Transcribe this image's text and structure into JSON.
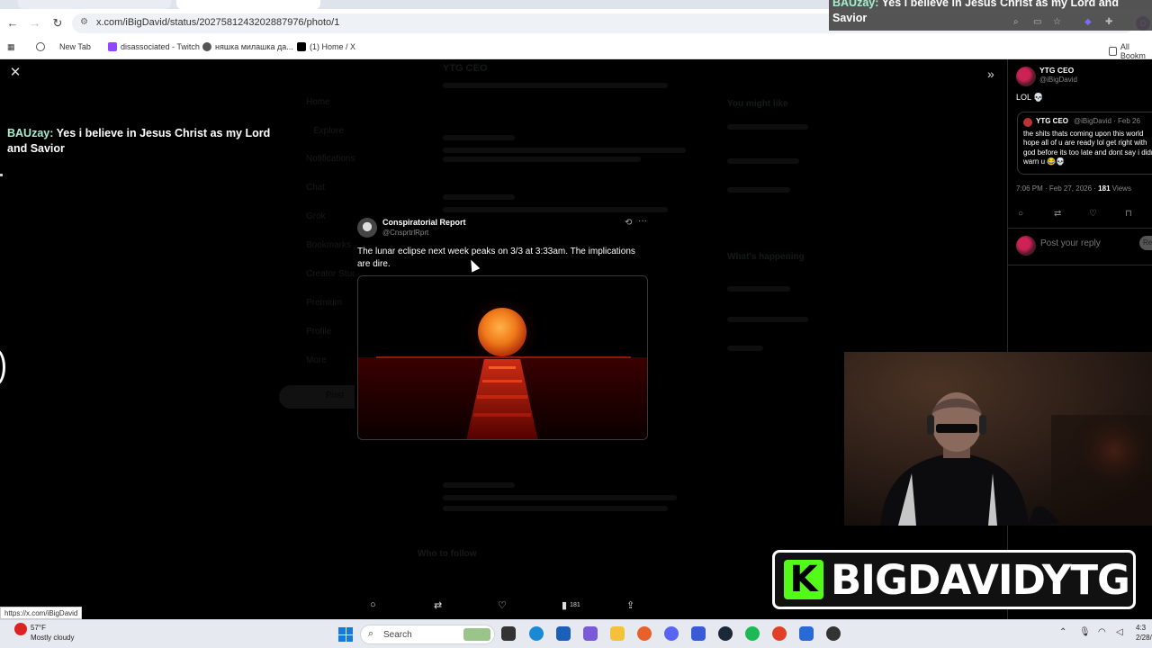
{
  "browser": {
    "url": "x.com/iBigDavid/status/2027581243202887976/photo/1",
    "bookmarks": [
      "New Tab",
      "disassociated - Twitch",
      "няшка милашка да...",
      "(1) Home / X"
    ],
    "all_bookmarks": "All Bookm"
  },
  "stream_overlay": {
    "user": "BAUzay:",
    "line1": " Yes i believe in Jesus Christ as my Lord and",
    "line2": "Savior"
  },
  "chat": {
    "user": "BAUzay:",
    "message": " Yes i believe in Jesus Christ as my Lord and Savior"
  },
  "post": {
    "author_name": "Conspiratorial Report",
    "author_handle": "@CnsprtrlRprt",
    "text": "The lunar eclipse next week peaks on 3/3 at 3:33am. The implications are dire.",
    "views": "181"
  },
  "background_feed": {
    "header": "YTG CEO",
    "nav": [
      "Home",
      "Explore",
      "Notifications",
      "Chat",
      "Grok",
      "Bookmarks",
      "Creator Studio",
      "Premium",
      "Profile",
      "More"
    ],
    "post_button": "Post",
    "sidebar_headers": [
      "You might like",
      "What's happening"
    ],
    "who_to_follow": "Who to follow"
  },
  "right_pane": {
    "name": "YTG CEO",
    "handle": "@iBigDavid",
    "text": "LOL 💀",
    "quote_name": "YTG CEO",
    "quote_meta": "@iBigDavid · Feb 26",
    "quote_text": "the shits thats coming upon this world hope all of u are ready lol get right with god before its too late and dont say i didnt warn u 😂💀",
    "time": "7:06 PM · Feb 27, 2026 · ",
    "views_count": "181",
    "views_label": " Views",
    "reply_placeholder": "Post your reply",
    "reply_button": "Reply"
  },
  "status_bar_url": "https://x.com/iBigDavid",
  "logo_text": "BIGDAVIDYTG",
  "taskbar": {
    "temperature": "57°F",
    "weather": "Mostly cloudy",
    "search_label": "Search",
    "time": "4:3",
    "date": "2/28/"
  },
  "colors": {
    "chat_user": "#a7f0cf",
    "kick_green": "#53fc18",
    "moon": "#f07a1a"
  }
}
